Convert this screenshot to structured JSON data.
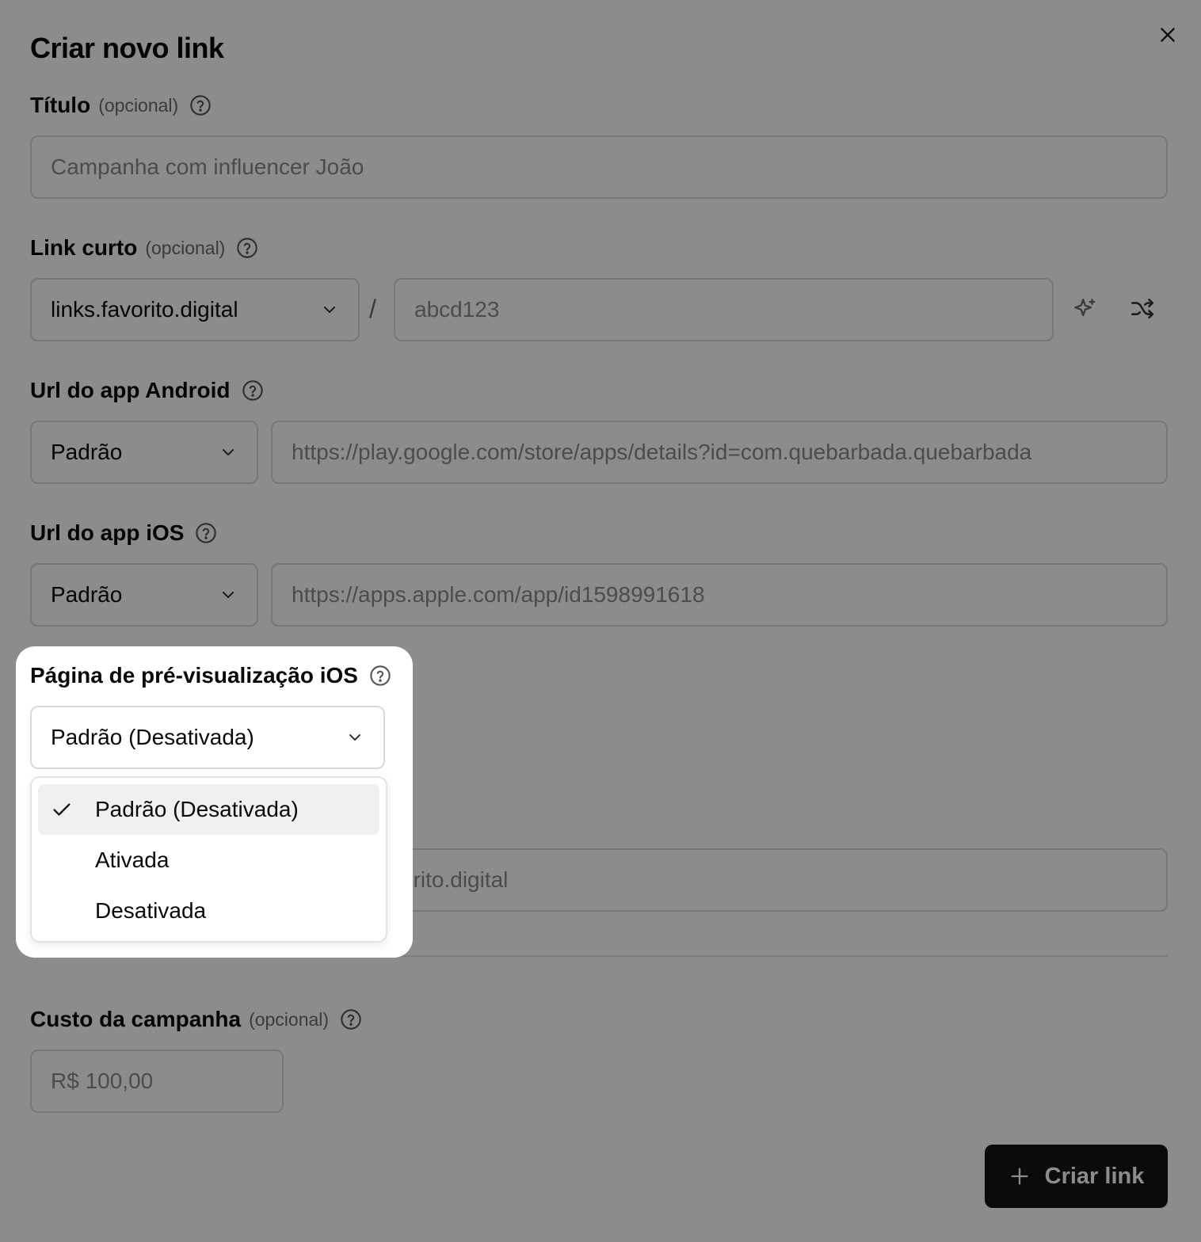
{
  "dialog": {
    "title": "Criar novo link",
    "submit_label": "Criar link"
  },
  "fields": {
    "titulo": {
      "label": "Título",
      "optional": "(opcional)",
      "placeholder": "Campanha com influencer João"
    },
    "link_curto": {
      "label": "Link curto",
      "optional": "(opcional)",
      "domain": "links.favorito.digital",
      "separator": "/",
      "placeholder": "abcd123"
    },
    "android": {
      "label": "Url do app Android",
      "select_value": "Padrão",
      "placeholder": "https://play.google.com/store/apps/details?id=com.quebarbada.quebarbada"
    },
    "ios": {
      "label": "Url do app iOS",
      "select_value": "Padrão",
      "placeholder": "https://apps.apple.com/app/id1598991618"
    },
    "preview_ios": {
      "label": "Página de pré-visualização iOS",
      "select_value": "Padrão (Desativada)",
      "options": [
        "Padrão (Desativada)",
        "Ativada",
        "Desativada"
      ],
      "selected_index": 0
    },
    "hidden_field": {
      "visible_text": "vorito.digital"
    },
    "custo": {
      "label": "Custo da campanha",
      "optional": "(opcional)",
      "placeholder": "R$ 100,00"
    }
  },
  "icons": {
    "close": "close-icon",
    "help": "help-circle-icon",
    "chevron": "chevron-down-icon",
    "sparkle": "sparkle-icon",
    "shuffle": "shuffle-icon",
    "check": "check-icon",
    "plus": "plus-icon"
  },
  "colors": {
    "primary_button": "#141414",
    "overlay": "rgba(0,0,0,0.45)",
    "selected_option_bg": "#f0f0f0"
  }
}
